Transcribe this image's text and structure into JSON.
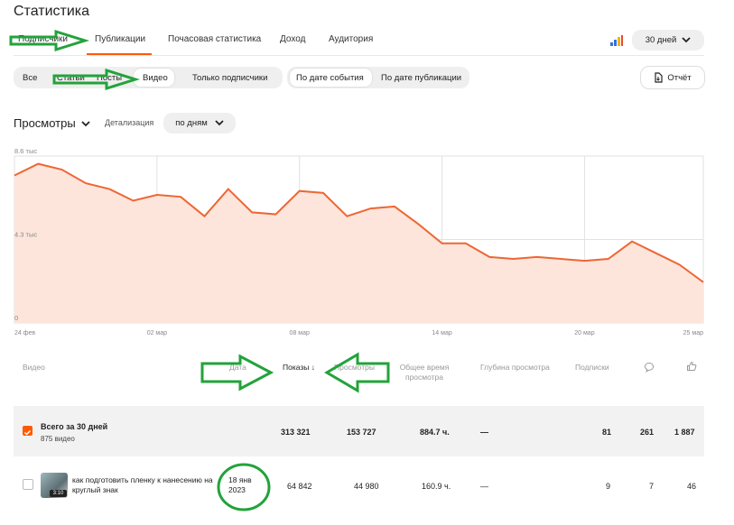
{
  "page_title": "Статистика",
  "tabs": [
    {
      "label": "Подписчики"
    },
    {
      "label": "Публикации"
    },
    {
      "label": "Почасовая статистика"
    },
    {
      "label": "Доход"
    },
    {
      "label": "Аудитория"
    }
  ],
  "period_dropdown": "30 дней",
  "filters": {
    "content": [
      "Все",
      "Статьи",
      "Посты",
      "Видео",
      "Только подписчики"
    ],
    "date_mode": [
      "По дате события",
      "По дате публикации"
    ],
    "report_button": "Отчёт"
  },
  "metric": {
    "title": "Просмотры",
    "detail_label": "Детализация",
    "detail_value": "по дням"
  },
  "colors": {
    "accent": "#ff5a00",
    "annotation": "#22a33a",
    "chart_line": "#ee6633",
    "chart_fill": "#fde5dc"
  },
  "chart_data": {
    "type": "area",
    "y_tick_labels": [
      "8.6 тыс",
      "4.3 тыс",
      "0"
    ],
    "x_tick_labels": [
      "24 фев",
      "02 мар",
      "08 мар",
      "14 мар",
      "20 мар",
      "25 мар"
    ],
    "ylim": [
      0,
      8600
    ],
    "grid": true,
    "values": [
      7600,
      8200,
      7900,
      7200,
      6900,
      6300,
      6600,
      6500,
      5500,
      6900,
      5700,
      5600,
      6800,
      6700,
      5500,
      5900,
      6000,
      5100,
      4100,
      4100,
      3400,
      3300,
      3400,
      3300,
      3200,
      3300,
      4200,
      3600,
      3000,
      2100
    ]
  },
  "table": {
    "headers": {
      "video": "Видео",
      "date": "Дата",
      "impressions": "Показы",
      "views": "Просмотры",
      "watch_time": "Общее время просмотра",
      "depth": "Глубина просмотра",
      "subscriptions": "Подписки",
      "comments": "comment-icon",
      "likes": "like-icon"
    },
    "total": {
      "title": "Всего за 30 дней",
      "subtitle": "875 видео",
      "impressions": "313 321",
      "views": "153 727",
      "watch_time": "884.7 ч.",
      "depth": "—",
      "subscriptions": "81",
      "comments": "261",
      "likes": "1 887"
    },
    "rows": [
      {
        "title": "как подготовить пленку к нанесению на круглый знак",
        "duration": "3:10",
        "date_line1": "18 янв",
        "date_line2": "2023",
        "impressions": "64 842",
        "views": "44 980",
        "watch_time": "160.9 ч.",
        "depth": "—",
        "subscriptions": "9",
        "comments": "7",
        "likes": "46"
      }
    ]
  }
}
